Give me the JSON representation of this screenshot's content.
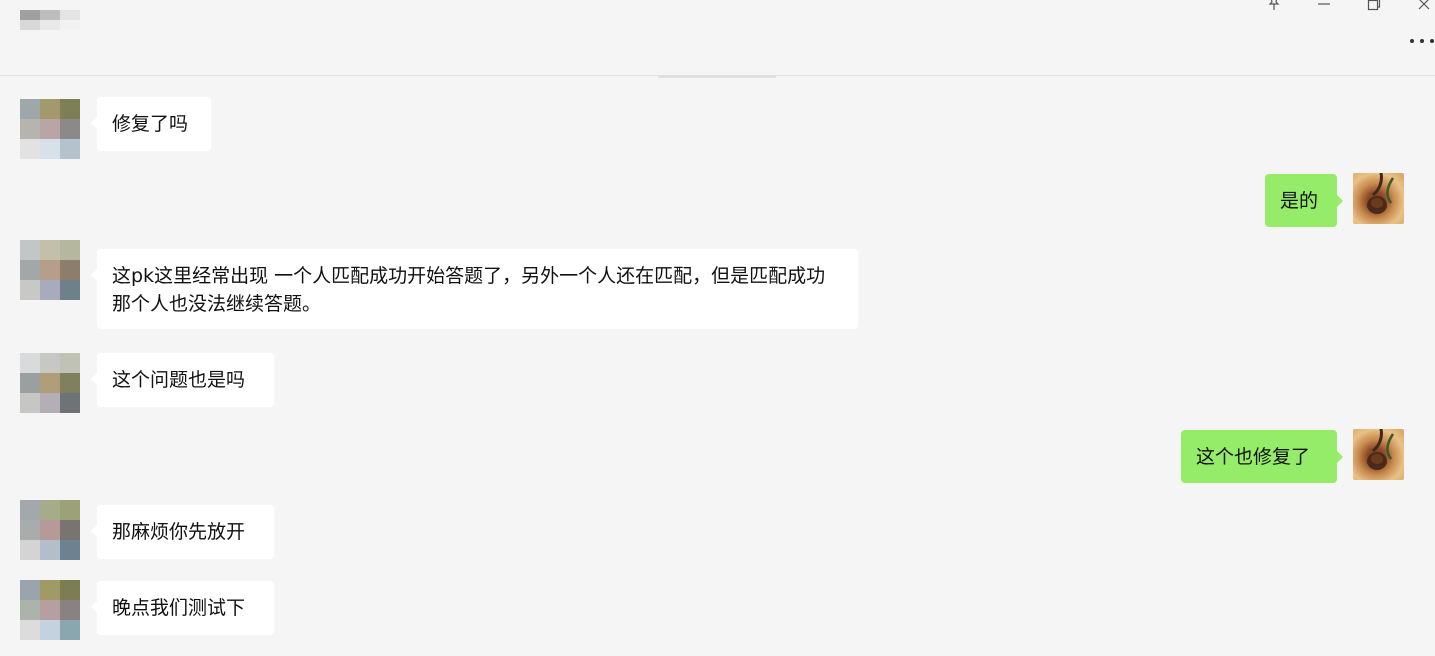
{
  "window": {
    "pin_icon": "pin-icon",
    "minimize_icon": "minimize-icon",
    "restore_icon": "restore-icon",
    "close_icon": "close-icon",
    "more_icon": "more-icon"
  },
  "header": {
    "contact_name": "",
    "avatar": "blurred-avatar"
  },
  "colors": {
    "background": "#f5f5f5",
    "incoming_bubble": "#ffffff",
    "outgoing_bubble": "#95ec69",
    "text": "#111111"
  },
  "messages": [
    {
      "side": "left",
      "text": "修复了吗"
    },
    {
      "side": "right",
      "text": "是的"
    },
    {
      "side": "left",
      "text": "这pk这里经常出现  一个人匹配成功开始答题了，另外一个人还在匹配，但是匹配成功那个人也没法继续答题。"
    },
    {
      "side": "left",
      "text": "这个问题也是吗"
    },
    {
      "side": "right",
      "text": "这个也修复了"
    },
    {
      "side": "left",
      "text": "那麻烦你先放开"
    },
    {
      "side": "left",
      "text": "晚点我们测试下"
    }
  ]
}
